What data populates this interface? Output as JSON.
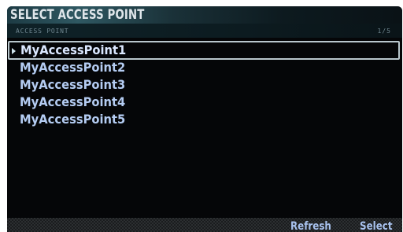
{
  "header": {
    "title": "SELECT ACCESS POINT",
    "sub_label": "ACCESS POINT",
    "page_indicator": "1/5"
  },
  "list": {
    "selected_index": 0,
    "items": [
      {
        "label": "MyAccessPoint1"
      },
      {
        "label": "MyAccessPoint2"
      },
      {
        "label": "MyAccessPoint3"
      },
      {
        "label": "MyAccessPoint4"
      },
      {
        "label": "MyAccessPoint5"
      }
    ]
  },
  "footer": {
    "refresh_label": "Refresh",
    "select_label": "Select"
  },
  "colors": {
    "background": "#050608",
    "item_text": "#b4ccf2",
    "selection_border": "#b8c6cc",
    "title_text": "#dfe6ea"
  },
  "icons": {
    "selection_caret": "caret-right-icon"
  }
}
